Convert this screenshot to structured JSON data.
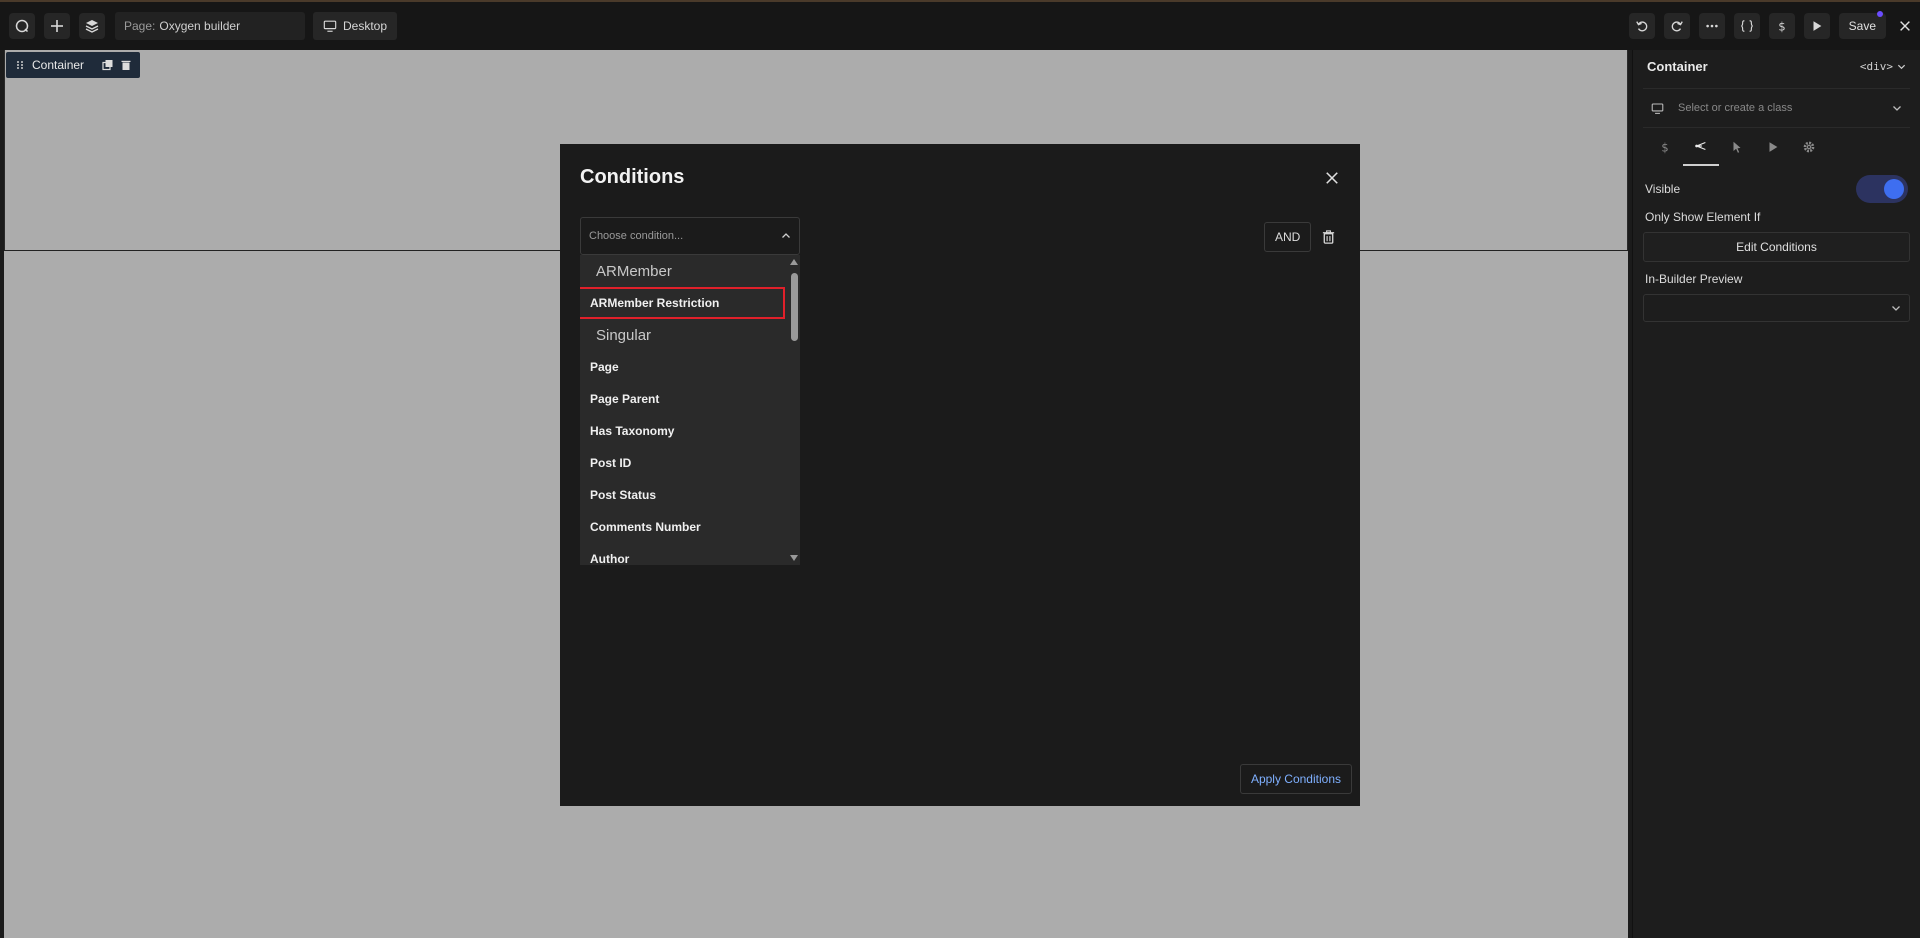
{
  "topbar": {
    "page_prefix": "Page:",
    "page_name": "Oxygen builder",
    "device_label": "Desktop",
    "save_label": "Save"
  },
  "canvas": {
    "container_tag_label": "Container"
  },
  "panel": {
    "title": "Container",
    "element_tag": "<div>",
    "class_placeholder": "Select or create a class",
    "visible_label": "Visible",
    "only_show_label": "Only Show Element If",
    "edit_conditions_label": "Edit Conditions",
    "in_builder_preview_label": "In-Builder Preview"
  },
  "modal": {
    "title": "Conditions",
    "condition_placeholder": "Choose condition...",
    "and_label": "AND",
    "apply_label": "Apply Conditions",
    "dropdown": {
      "group_1": "ARMember",
      "item_selected": "ARMember Restriction",
      "group_2": "Singular",
      "items": [
        "Page",
        "Page Parent",
        "Has Taxonomy",
        "Post ID",
        "Post Status",
        "Comments Number",
        "Author"
      ]
    }
  }
}
